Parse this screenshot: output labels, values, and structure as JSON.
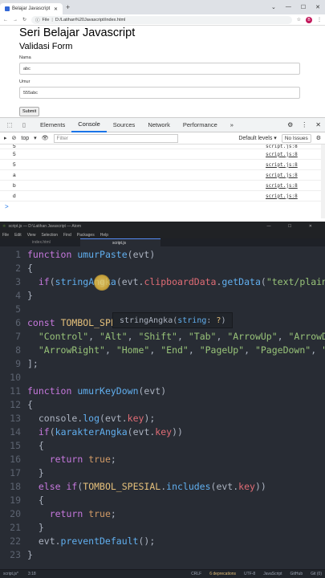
{
  "browser": {
    "tab_title": "Belajar Javascript",
    "url_prefix": "File",
    "url": "D:/Latihan%20Javascript/index.html",
    "avatar_letter": "B"
  },
  "page": {
    "title": "Seri Belajar Javascript",
    "subtitle": "Validasi Form",
    "nama_label": "Nama",
    "nama_value": "abc",
    "umur_label": "Umur",
    "umur_value": "555abc",
    "submit_label": "Submit"
  },
  "devtools": {
    "tabs": [
      "Elements",
      "Console",
      "Sources",
      "Network",
      "Performance"
    ],
    "more": "»",
    "context": "top",
    "filter_placeholder": "Filter",
    "levels": "Default levels ▾",
    "issues": "No Issues",
    "rows": [
      {
        "text": "5",
        "src": "script.js:8"
      },
      {
        "text": "5",
        "src": "script.js:8"
      },
      {
        "text": "5",
        "src": "script.js:8"
      },
      {
        "text": "a",
        "src": "script.js:8"
      },
      {
        "text": "b",
        "src": "script.js:8"
      },
      {
        "text": "d",
        "src": "script.js:8"
      }
    ],
    "prompt": ">"
  },
  "atom": {
    "title": "script.js — D:\\Latihan Javascript — Atom",
    "menu": [
      "File",
      "Edit",
      "View",
      "Selection",
      "Find",
      "Packages",
      "Help"
    ],
    "tab_inactive": "index.html",
    "tab_active": "script.js",
    "tooltip_fn": "stringAngka(",
    "tooltip_param": "string",
    "tooltip_type": "?",
    "tooltip_close": ")",
    "status": {
      "file": "script.js*",
      "pos": "3:18",
      "eol": "CRLF",
      "deprecations": "6 deprecations",
      "encoding": "UTF-8",
      "grammar": "JavaScript",
      "github": "GitHub",
      "git": "Git (0)"
    }
  }
}
